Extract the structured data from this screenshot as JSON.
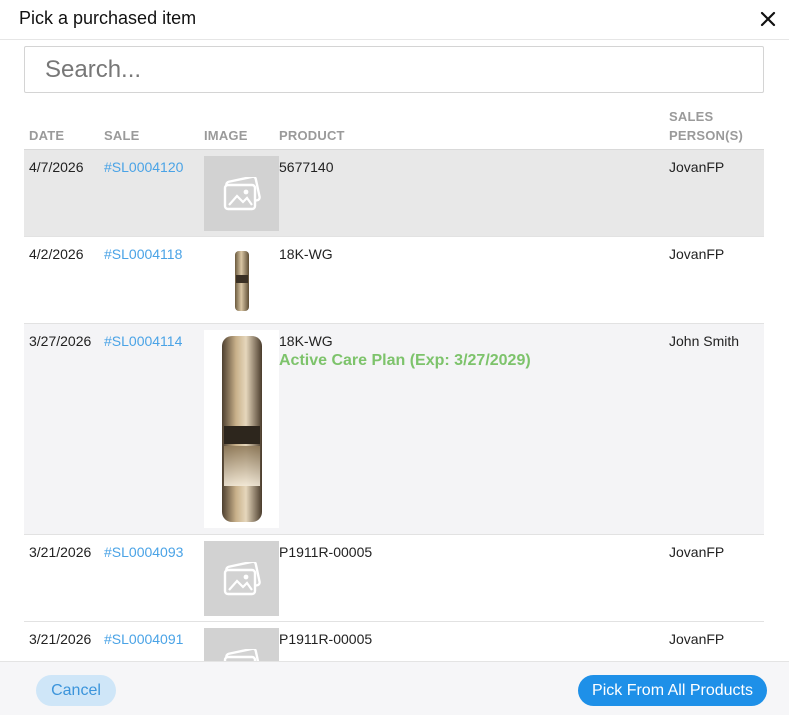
{
  "dialog": {
    "title": "Pick a purchased item",
    "close_icon": "close-icon"
  },
  "search": {
    "placeholder": "Search...",
    "value": ""
  },
  "table": {
    "headers": {
      "date": "DATE",
      "sale": "SALE",
      "image": "IMAGE",
      "product": "PRODUCT",
      "sales_person_1": "SALES",
      "sales_person_2": "PERSON(S)"
    },
    "rows": [
      {
        "date": "4/7/2026",
        "sale": "#SL0004120",
        "image": "image-placeholder-icon",
        "product": "5677140",
        "care_plan": "",
        "sales_person": "JovanFP"
      },
      {
        "date": "4/2/2026",
        "sale": "#SL0004118",
        "image": "ring-thumbnail",
        "product": "18K-WG",
        "care_plan": "",
        "sales_person": "JovanFP"
      },
      {
        "date": "3/27/2026",
        "sale": "#SL0004114",
        "image": "ring-photo",
        "product": "18K-WG",
        "care_plan": "Active Care Plan (Exp: 3/27/2029)",
        "sales_person": "John Smith"
      },
      {
        "date": "3/21/2026",
        "sale": "#SL0004093",
        "image": "image-placeholder-icon",
        "product": "P1911R-00005",
        "care_plan": "",
        "sales_person": "JovanFP"
      },
      {
        "date": "3/21/2026",
        "sale": "#SL0004091",
        "image": "image-placeholder-icon",
        "product": "P1911R-00005",
        "care_plan": "",
        "sales_person": "JovanFP"
      }
    ]
  },
  "footer": {
    "cancel_label": "Cancel",
    "pick_all_label": "Pick From All Products"
  },
  "colors": {
    "link": "#4aa3e6",
    "care_plan": "#7dc36b",
    "primary_button": "#1e90e8",
    "secondary_button": "#cfe6f8"
  }
}
